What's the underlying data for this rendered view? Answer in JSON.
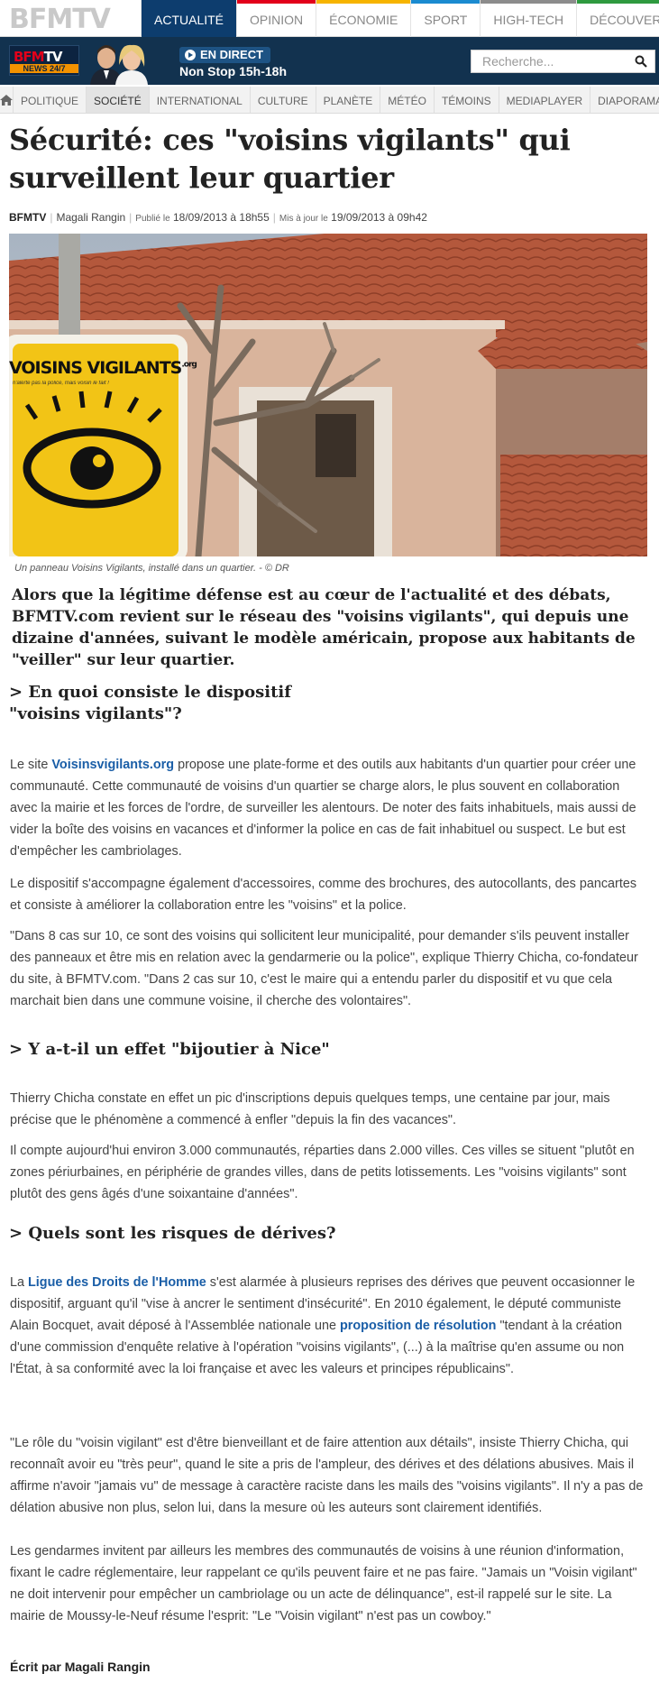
{
  "header": {
    "logo": "BFMTV",
    "tabs": [
      {
        "label": "ACTUALITÉ",
        "color": "#0d3d6e",
        "active": true
      },
      {
        "label": "OPINION",
        "color": "#e2001a"
      },
      {
        "label": "ÉCONOMIE",
        "color": "#f6b400"
      },
      {
        "label": "SPORT",
        "color": "#1b8bd0"
      },
      {
        "label": "HIGH-TECH",
        "color": "#8c8c8c"
      },
      {
        "label": "DÉCOUVERTE",
        "color": "#2e9a3f"
      }
    ]
  },
  "live": {
    "channel_logo": "BFMTV",
    "channel_sub": "NEWS 24/7",
    "badge": "EN DIRECT",
    "program": "Non Stop 15h-18h",
    "search_placeholder": "Recherche..."
  },
  "subnav": {
    "home_icon": "home-icon",
    "items": [
      "POLITIQUE",
      "SOCIÉTÉ",
      "INTERNATIONAL",
      "CULTURE",
      "PLANÈTE",
      "MÉTÉO",
      "TÉMOINS",
      "MEDIAPLAYER",
      "DIAPORAMAS"
    ],
    "active_index": 1
  },
  "article": {
    "title": "Sécurité: ces \"voisins vigilants\" qui surveillent leur quartier",
    "source": "BFMTV",
    "author": "Magali Rangin",
    "published_label": "Publié le",
    "published_date": "18/09/2013 à 18h55",
    "updated_label": "Mis à jour le",
    "updated_date": "19/09/2013 à 09h42",
    "image_sign_text": "VOISINS VIGILANTS",
    "image_sign_suffix": ".org",
    "image_sign_tagline": "n'alerte pas la police, mais voisin le fait !",
    "caption": "Un panneau Voisins Vigilants, installé dans un quartier. - © DR",
    "chapo": "Alors que la légitime défense est au cœur de l'actualité et des débats, BFMTV.com revient sur le réseau des \"voisins vigilants\", qui depuis une dizaine d'années, suivant le modèle américain, propose aux habitants de \"veiller\" sur leur quartier.",
    "section1_title": "> En quoi consiste le dispositif \"voisins vigilants\"?",
    "p1_pre": "Le site ",
    "p1_link": "Voisinsvigilants.org",
    "p1_post": " propose une plate-forme et des outils aux habitants d'un quartier pour créer une communauté. Cette communauté de voisins d'un quartier se charge alors, le plus souvent en collaboration avec la mairie et les forces de l'ordre, de surveiller les alentours. De noter des faits inhabituels, mais aussi de vider la boîte des voisins en vacances et d'informer la police en cas de fait inhabituel ou suspect. Le but est d'empêcher les cambriolages.",
    "p2": "Le dispositif s'accompagne également d'accessoires, comme des brochures, des autocollants, des pancartes et consiste à améliorer la collaboration entre les \"voisins\" et la police.",
    "p3": "\"Dans 8 cas sur 10, ce sont des voisins qui sollicitent leur municipalité, pour demander s'ils peuvent installer des panneaux et être mis en relation avec la gendarmerie ou la police\", explique Thierry Chicha, co-fondateur du site, à BFMTV.com. \"Dans 2 cas sur 10, c'est le maire qui a entendu parler du dispositif et vu que cela marchait bien dans une commune voisine, il cherche des volontaires\".",
    "section2_title": "> Y a-t-il un effet \"bijoutier à Nice\"",
    "p4": "Thierry Chicha constate en effet un pic d'inscriptions depuis quelques temps, une centaine par jour, mais précise que le phénomène a commencé à enfler \"depuis la fin des vacances\".",
    "p5": "Il compte aujourd'hui environ 3.000 communautés, réparties dans 2.000 villes. Ces villes se situent \"plutôt en zones périurbaines, en périphérie de grandes villes, dans de petits lotissements. Les \"voisins vigilants\" sont plutôt des gens âgés d'une soixantaine d'années\".",
    "section3_title": "> Quels sont les risques de dérives?",
    "p6_a": "La ",
    "p6_link1": "Ligue des Droits de l'Homme",
    "p6_b": " s'est alarmée à plusieurs reprises des dérives que peuvent occasionner le dispositif, arguant qu'il \"vise à ancrer le sentiment d'insécurité\". En 2010 également, le député communiste Alain Bocquet, avait déposé à l'Assemblée nationale une ",
    "p6_link2": "proposition de résolution",
    "p6_c": " \"tendant à la création d'une commission d'enquête relative à l'opération \"voisins vigilants\", (...) à la maîtrise qu'en assume ou non l'État, à sa conformité avec la loi française et avec les valeurs et principes républicains\".",
    "p7": "\"Le rôle du \"voisin vigilant\" est d'être bienveillant et de faire attention aux détails\", insiste Thierry Chicha, qui reconnaît avoir eu \"très peur\", quand le site a pris de l'ampleur, des dérives et des délations abusives. Mais il affirme n'avoir \"jamais vu\" de message à caractère raciste dans les mails des \"voisins vigilants\". Il n'y a pas de délation abusive non plus, selon lui, dans la mesure où les auteurs sont clairement identifiés.",
    "p8": "Les gendarmes invitent par ailleurs les membres des communautés de voisins à une réunion d'information, fixant le cadre réglementaire, leur rappelant ce qu'ils peuvent faire et ne pas faire. \"Jamais un \"Voisin vigilant\" ne doit intervenir  pour empêcher un cambriolage ou un acte de délinquance\", est-il rappelé sur le site. La mairie de Moussy-le-Neuf résume l'esprit: \"Le \"Voisin vigilant\" n'est pas un cowboy.\"",
    "signature": "Écrit par Magali Rangin"
  }
}
